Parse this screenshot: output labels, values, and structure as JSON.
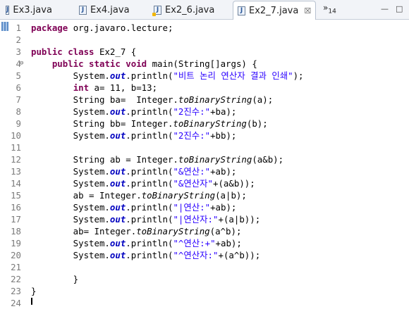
{
  "tabs": [
    {
      "label": "Ex3.java",
      "active": false
    },
    {
      "label": "Ex4.java",
      "active": false
    },
    {
      "label": "Ex2_6.java",
      "active": false
    },
    {
      "label": "Ex2_7.java",
      "active": true,
      "close": "☒"
    }
  ],
  "overflow": {
    "symbol": "»",
    "count": "14"
  },
  "window_buttons": {
    "minimize": "—",
    "maximize": "□"
  },
  "code_lines": [
    {
      "n": "1",
      "tokens": [
        [
          "kw",
          "package"
        ],
        [
          "",
          "org.javaro.lecture;"
        ]
      ]
    },
    {
      "n": "2",
      "tokens": []
    },
    {
      "n": "3",
      "tokens": [
        [
          "kw",
          "public class"
        ],
        [
          "",
          "Ex2_7 {"
        ]
      ]
    },
    {
      "n": "4",
      "fold": "⊖",
      "tokens": [
        [
          "",
          "    "
        ],
        [
          "kw",
          "public static void"
        ],
        [
          "",
          "main(String[]args) {"
        ]
      ]
    },
    {
      "n": "5",
      "tokens": [
        [
          "",
          "        System."
        ],
        [
          "st",
          "out"
        ],
        [
          "",
          ".println("
        ],
        [
          "str",
          "\"비트 논리 연산자 결과 인쇄\""
        ],
        [
          "",
          ");"
        ]
      ]
    },
    {
      "n": "6",
      "tokens": [
        [
          "",
          "        "
        ],
        [
          "kw",
          "int"
        ],
        [
          "",
          "a= 11, b=13;"
        ]
      ]
    },
    {
      "n": "7",
      "tokens": [
        [
          "",
          "        String ba=  Integer."
        ],
        [
          "it",
          "toBinaryString"
        ],
        [
          "",
          "(a);"
        ]
      ]
    },
    {
      "n": "8",
      "tokens": [
        [
          "",
          "        System."
        ],
        [
          "st",
          "out"
        ],
        [
          "",
          ".println("
        ],
        [
          "str",
          "\"2진수:\""
        ],
        [
          "",
          "+ba);"
        ]
      ]
    },
    {
      "n": "9",
      "tokens": [
        [
          "",
          "        String bb= Integer."
        ],
        [
          "it",
          "toBinaryString"
        ],
        [
          "",
          "(b);"
        ]
      ]
    },
    {
      "n": "10",
      "tokens": [
        [
          "",
          "        System."
        ],
        [
          "st",
          "out"
        ],
        [
          "",
          ".println("
        ],
        [
          "str",
          "\"2진수:\""
        ],
        [
          "",
          "+bb);"
        ]
      ]
    },
    {
      "n": "11",
      "tokens": []
    },
    {
      "n": "12",
      "tokens": [
        [
          "",
          "        String ab = Integer."
        ],
        [
          "it",
          "toBinaryString"
        ],
        [
          "",
          "(a&b);"
        ]
      ]
    },
    {
      "n": "13",
      "tokens": [
        [
          "",
          "        System."
        ],
        [
          "st",
          "out"
        ],
        [
          "",
          ".println("
        ],
        [
          "str",
          "\"&연산:\""
        ],
        [
          "",
          "+ab);"
        ]
      ]
    },
    {
      "n": "14",
      "tokens": [
        [
          "",
          "        System."
        ],
        [
          "st",
          "out"
        ],
        [
          "",
          ".println("
        ],
        [
          "str",
          "\"&연산자\""
        ],
        [
          "",
          "+(a&b));"
        ]
      ]
    },
    {
      "n": "15",
      "tokens": [
        [
          "",
          "        ab = Integer."
        ],
        [
          "it",
          "toBinaryString"
        ],
        [
          "",
          "(a|b);"
        ]
      ]
    },
    {
      "n": "16",
      "tokens": [
        [
          "",
          "        System."
        ],
        [
          "st",
          "out"
        ],
        [
          "",
          ".println("
        ],
        [
          "str",
          "\"|연산:\""
        ],
        [
          "",
          "+ab);"
        ]
      ]
    },
    {
      "n": "17",
      "tokens": [
        [
          "",
          "        System."
        ],
        [
          "st",
          "out"
        ],
        [
          "",
          ".println("
        ],
        [
          "str",
          "\"|연산자:\""
        ],
        [
          "",
          "+(a|b));"
        ]
      ]
    },
    {
      "n": "18",
      "tokens": [
        [
          "",
          "        ab= Integer."
        ],
        [
          "it",
          "toBinaryString"
        ],
        [
          "",
          "(a^b);"
        ]
      ]
    },
    {
      "n": "19",
      "tokens": [
        [
          "",
          "        System."
        ],
        [
          "st",
          "out"
        ],
        [
          "",
          ".println("
        ],
        [
          "str",
          "\"^연산:+\""
        ],
        [
          "",
          "+ab);"
        ]
      ]
    },
    {
      "n": "20",
      "tokens": [
        [
          "",
          "        System."
        ],
        [
          "st",
          "out"
        ],
        [
          "",
          ".println("
        ],
        [
          "str",
          "\"^연산자:\""
        ],
        [
          "",
          "+(a^b));"
        ]
      ]
    },
    {
      "n": "21",
      "tokens": []
    },
    {
      "n": "22",
      "tokens": [
        [
          "",
          "        }"
        ]
      ]
    },
    {
      "n": "23",
      "tokens": [
        [
          "",
          "}"
        ]
      ]
    },
    {
      "n": "24",
      "tokens": []
    }
  ],
  "colors": {
    "keyword": "#7f0055",
    "string": "#2a00ff",
    "static_field": "#0000c0",
    "line_number": "#7a7a7a"
  }
}
